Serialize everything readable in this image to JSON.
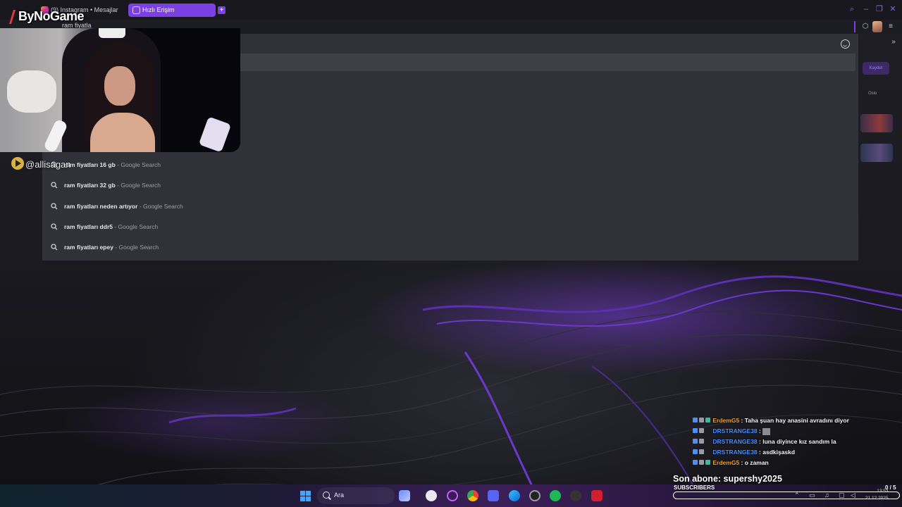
{
  "browser": {
    "tabs": [
      {
        "label": "(9) Instagram • Mesajlar",
        "active": false
      },
      {
        "label": "Hızlı Erişim",
        "active": true
      }
    ],
    "new_tab_icon": "plus-icon",
    "address_text": "ram fiyatla",
    "accent_color": "#7b3fe4"
  },
  "suggestions": [
    {
      "bold": "ram fiyatla",
      "rest": "rı 16 gb",
      "source": "- Google Search"
    },
    {
      "bold": "ram fiyatla",
      "rest": "rı 32 gb",
      "source": "- Google Search"
    },
    {
      "bold": "ram fiyatla",
      "rest": "rı neden artıyor",
      "source": "- Google Search"
    },
    {
      "bold": "ram fiyatla",
      "rest": "rı ddr5",
      "source": "- Google Search"
    },
    {
      "bold": "ram fiyatla",
      "rest": "rı epey",
      "source": "- Google Search"
    }
  ],
  "side_panel": {
    "button_label": "Kaydet",
    "text": "Oslo"
  },
  "overlay": {
    "brand": "ByNoGame",
    "handle": "@allisagan"
  },
  "chat": [
    {
      "user": "ErdemG5",
      "user_color": "#f0a030",
      "message": ": Taha şuan hay anasini avradını diyor"
    },
    {
      "user": "DRSTRANGE38",
      "user_color": "#4a8fff",
      "message": ":",
      "emote": true
    },
    {
      "user": "DRSTRANGE38",
      "user_color": "#4a8fff",
      "message": ": luna diyince kız sandım la"
    },
    {
      "user": "DRSTRANGE38",
      "user_color": "#4a8fff",
      "message": ": asdkişaskd"
    },
    {
      "user": "ErdemG5",
      "user_color": "#f0a030",
      "message": ": o zaman"
    }
  ],
  "subscriber_goal": {
    "last_sub_label": "Son abone: supershy2025",
    "label": "SUBSCRIBERS",
    "count": "0 / 5",
    "progress": 0.0
  },
  "taskbar": {
    "search_placeholder": "Ara",
    "time": "13:53",
    "date": "21.12.2025"
  }
}
